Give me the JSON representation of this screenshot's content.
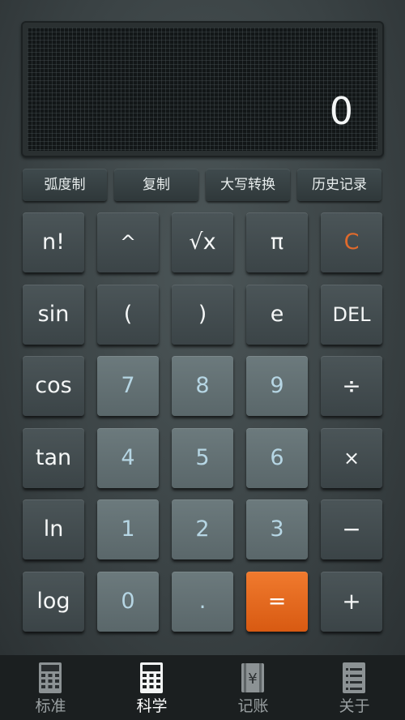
{
  "display": {
    "value": "0"
  },
  "function_buttons": [
    {
      "label": "弧度制"
    },
    {
      "label": "复制"
    },
    {
      "label": "大写转换"
    },
    {
      "label": "历史记录"
    }
  ],
  "keys": {
    "factorial": "n!",
    "power": "^",
    "sqrt": "√x",
    "pi": "π",
    "clear": "C",
    "sin": "sin",
    "lparen": "(",
    "rparen": ")",
    "e": "e",
    "del": "DEL",
    "cos": "cos",
    "d7": "7",
    "d8": "8",
    "d9": "9",
    "divide": "÷",
    "tan": "tan",
    "d4": "4",
    "d5": "5",
    "d6": "6",
    "multiply": "×",
    "ln": "ln",
    "d1": "1",
    "d2": "2",
    "d3": "3",
    "minus": "−",
    "log": "log",
    "d0": "0",
    "dot": ".",
    "equals": "=",
    "plus": "+"
  },
  "tabs": [
    {
      "label": "标准",
      "icon": "calculator-icon"
    },
    {
      "label": "科学",
      "icon": "calculator-icon"
    },
    {
      "label": "记账",
      "icon": "ledger-icon"
    },
    {
      "label": "关于",
      "icon": "list-icon"
    }
  ],
  "colors": {
    "accent": "#e8661d",
    "clear_text": "#e06a2c",
    "number_text": "#b6d6e4"
  }
}
